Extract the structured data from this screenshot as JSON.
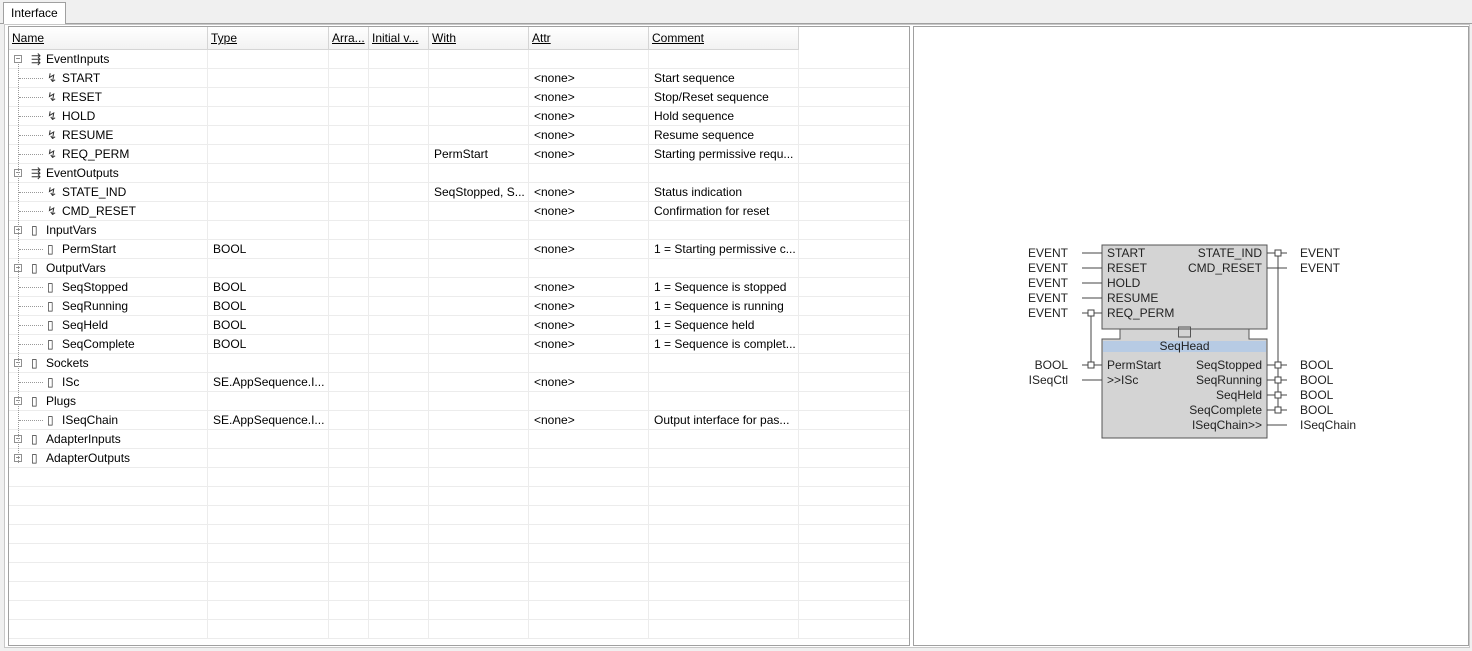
{
  "tab": {
    "label": "Interface"
  },
  "columns": [
    "Name",
    "Type",
    "Arra...",
    "Initial v...",
    "With",
    "Attr",
    "Comment"
  ],
  "rows": [
    {
      "name": "EventInputs",
      "group": true,
      "icon": "⇶",
      "type": "",
      "with": "",
      "attr": "",
      "comment": ""
    },
    {
      "name": "START",
      "group": false,
      "icon": "↯",
      "type": "",
      "with": "",
      "attr": "<none>",
      "comment": "Start sequence"
    },
    {
      "name": "RESET",
      "group": false,
      "icon": "↯",
      "type": "",
      "with": "",
      "attr": "<none>",
      "comment": "Stop/Reset sequence"
    },
    {
      "name": "HOLD",
      "group": false,
      "icon": "↯",
      "type": "",
      "with": "",
      "attr": "<none>",
      "comment": "Hold sequence"
    },
    {
      "name": "RESUME",
      "group": false,
      "icon": "↯",
      "type": "",
      "with": "",
      "attr": "<none>",
      "comment": "Resume sequence"
    },
    {
      "name": "REQ_PERM",
      "group": false,
      "icon": "↯",
      "type": "",
      "with": "PermStart",
      "attr": "<none>",
      "comment": "Starting permissive requ..."
    },
    {
      "name": "EventOutputs",
      "group": true,
      "icon": "⇶",
      "type": "",
      "with": "",
      "attr": "",
      "comment": ""
    },
    {
      "name": "STATE_IND",
      "group": false,
      "icon": "↯",
      "type": "",
      "with": "SeqStopped, S...",
      "attr": "<none>",
      "comment": "Status indication"
    },
    {
      "name": "CMD_RESET",
      "group": false,
      "icon": "↯",
      "type": "",
      "with": "",
      "attr": "<none>",
      "comment": "Confirmation for reset"
    },
    {
      "name": "InputVars",
      "group": true,
      "icon": "▯",
      "type": "",
      "with": "",
      "attr": "",
      "comment": ""
    },
    {
      "name": "PermStart",
      "group": false,
      "icon": "▯",
      "type": "BOOL",
      "with": "",
      "attr": "<none>",
      "comment": "1 = Starting permissive c..."
    },
    {
      "name": "OutputVars",
      "group": true,
      "icon": "▯",
      "type": "",
      "with": "",
      "attr": "",
      "comment": ""
    },
    {
      "name": "SeqStopped",
      "group": false,
      "icon": "▯",
      "type": "BOOL",
      "with": "",
      "attr": "<none>",
      "comment": "1 = Sequence is stopped"
    },
    {
      "name": "SeqRunning",
      "group": false,
      "icon": "▯",
      "type": "BOOL",
      "with": "",
      "attr": "<none>",
      "comment": "1 = Sequence is running"
    },
    {
      "name": "SeqHeld",
      "group": false,
      "icon": "▯",
      "type": "BOOL",
      "with": "",
      "attr": "<none>",
      "comment": "1 = Sequence held"
    },
    {
      "name": "SeqComplete",
      "group": false,
      "icon": "▯",
      "type": "BOOL",
      "with": "",
      "attr": "<none>",
      "comment": "1 = Sequence is complet..."
    },
    {
      "name": "Sockets",
      "group": true,
      "icon": "▯",
      "type": "",
      "with": "",
      "attr": "",
      "comment": ""
    },
    {
      "name": "ISc",
      "group": false,
      "icon": "▯",
      "type": "SE.AppSequence.I...",
      "with": "",
      "attr": "<none>",
      "comment": ""
    },
    {
      "name": "Plugs",
      "group": true,
      "icon": "▯",
      "type": "",
      "with": "",
      "attr": "",
      "comment": ""
    },
    {
      "name": "ISeqChain",
      "group": false,
      "icon": "▯",
      "type": "SE.AppSequence.I...",
      "with": "",
      "attr": "<none>",
      "comment": "Output interface for pas..."
    },
    {
      "name": "AdapterInputs",
      "group": true,
      "icon": "▯",
      "type": "",
      "with": "",
      "attr": "",
      "comment": ""
    },
    {
      "name": "AdapterOutputs",
      "group": true,
      "icon": "▯",
      "type": "",
      "with": "",
      "attr": "",
      "comment": ""
    }
  ],
  "fb": {
    "name": "SeqHead",
    "event_inputs": [
      {
        "type": "EVENT",
        "name": "START"
      },
      {
        "type": "EVENT",
        "name": "RESET"
      },
      {
        "type": "EVENT",
        "name": "HOLD"
      },
      {
        "type": "EVENT",
        "name": "RESUME"
      },
      {
        "type": "EVENT",
        "name": "REQ_PERM"
      }
    ],
    "event_outputs": [
      {
        "type": "EVENT",
        "name": "STATE_IND"
      },
      {
        "type": "EVENT",
        "name": "CMD_RESET"
      }
    ],
    "data_inputs": [
      {
        "type": "BOOL",
        "name": "PermStart"
      },
      {
        "type": "ISeqCtl",
        "name": ">>ISc"
      }
    ],
    "data_outputs": [
      {
        "type": "BOOL",
        "name": "SeqStopped"
      },
      {
        "type": "BOOL",
        "name": "SeqRunning"
      },
      {
        "type": "BOOL",
        "name": "SeqHeld"
      },
      {
        "type": "BOOL",
        "name": "SeqComplete"
      },
      {
        "type": "ISeqChain",
        "name": "ISeqChain>>"
      }
    ],
    "colors": {
      "body": "#d4d4d4",
      "header": "#b7cbe4",
      "border": "#555555"
    }
  }
}
